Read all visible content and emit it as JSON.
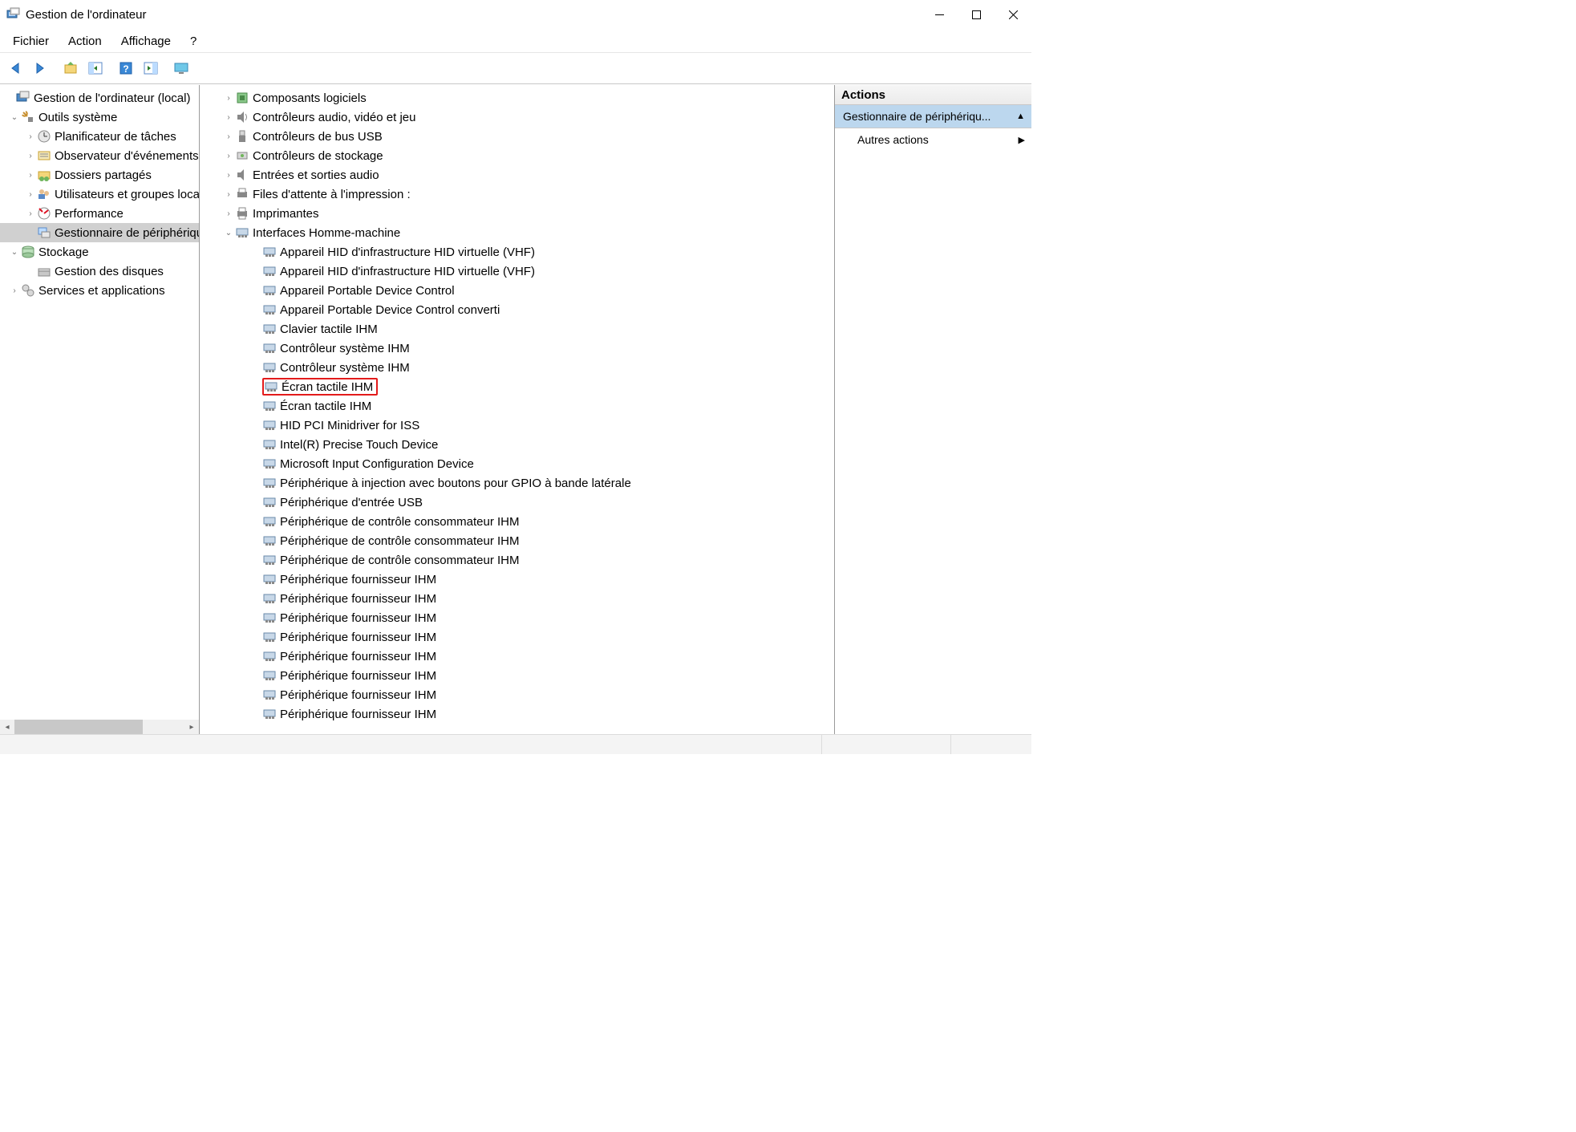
{
  "window": {
    "title": "Gestion de l'ordinateur"
  },
  "menu": {
    "fichier": "Fichier",
    "action": "Action",
    "affichage": "Affichage",
    "aide": "?"
  },
  "left_tree": {
    "root": "Gestion de l'ordinateur (local)",
    "outils": "Outils système",
    "planif": "Planificateur de tâches",
    "observ": "Observateur d'événements",
    "dossiers": "Dossiers partagés",
    "users": "Utilisateurs et groupes locaux",
    "perf": "Performance",
    "devmgr": "Gestionnaire de périphériques",
    "stockage": "Stockage",
    "disques": "Gestion des disques",
    "services": "Services et applications"
  },
  "center_tree": {
    "collapsed": {
      "composants": "Composants logiciels",
      "audio": "Contrôleurs audio, vidéo et jeu",
      "usb": "Contrôleurs de bus USB",
      "storage": "Contrôleurs de stockage",
      "sound": "Entrées et sorties audio",
      "printq": "Files d'attente à l'impression :",
      "printers": "Imprimantes"
    },
    "hid_group": "Interfaces Homme-machine",
    "hid_devices": [
      "Appareil HID d'infrastructure HID virtuelle (VHF)",
      "Appareil HID d'infrastructure HID virtuelle (VHF)",
      "Appareil Portable Device Control",
      "Appareil Portable Device Control converti",
      "Clavier tactile IHM",
      "Contrôleur système IHM",
      "Contrôleur système IHM",
      "Écran tactile IHM",
      "Écran tactile IHM",
      "HID PCI Minidriver for ISS",
      "Intel(R) Precise Touch Device",
      "Microsoft Input Configuration Device",
      "Périphérique à injection avec boutons pour GPIO à bande latérale",
      "Périphérique d'entrée USB",
      "Périphérique de contrôle consommateur IHM",
      "Périphérique de contrôle consommateur IHM",
      "Périphérique de contrôle consommateur IHM",
      "Périphérique fournisseur IHM",
      "Périphérique fournisseur IHM",
      "Périphérique fournisseur IHM",
      "Périphérique fournisseur IHM",
      "Périphérique fournisseur IHM",
      "Périphérique fournisseur IHM",
      "Périphérique fournisseur IHM",
      "Périphérique fournisseur IHM"
    ],
    "highlighted_index": 7
  },
  "actions": {
    "header": "Actions",
    "group": "Gestionnaire de périphériqu...",
    "more": "Autres actions"
  }
}
